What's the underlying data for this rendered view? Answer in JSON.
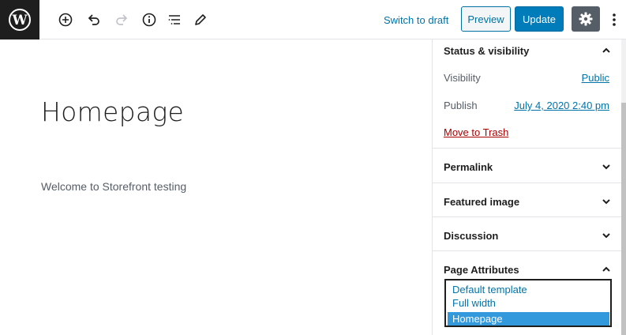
{
  "toolbar": {
    "switch_to_draft": "Switch to draft",
    "preview": "Preview",
    "update": "Update",
    "icons": [
      "wordpress-logo",
      "add-block-icon",
      "undo-icon",
      "redo-icon",
      "info-icon",
      "outline-icon",
      "edit-tools-icon",
      "settings-gear-icon",
      "more-options-icon"
    ]
  },
  "editor": {
    "title": "Homepage",
    "paragraph": "Welcome to Storefront testing"
  },
  "sidebar": {
    "status_panel": {
      "title": "Status & visibility",
      "visibility_label": "Visibility",
      "visibility_value": "Public",
      "publish_label": "Publish",
      "publish_value": "July 4, 2020 2:40 pm",
      "trash": "Move to Trash"
    },
    "permalink": "Permalink",
    "featured_image": "Featured image",
    "discussion": "Discussion",
    "page_attributes": {
      "title": "Page Attributes",
      "template_options": [
        "Default template",
        "Full width",
        "Homepage"
      ],
      "selected": "Homepage"
    }
  },
  "colors": {
    "accent": "#007cba",
    "link": "#0073aa",
    "danger": "#a00",
    "selected_option": "#3399dd"
  }
}
